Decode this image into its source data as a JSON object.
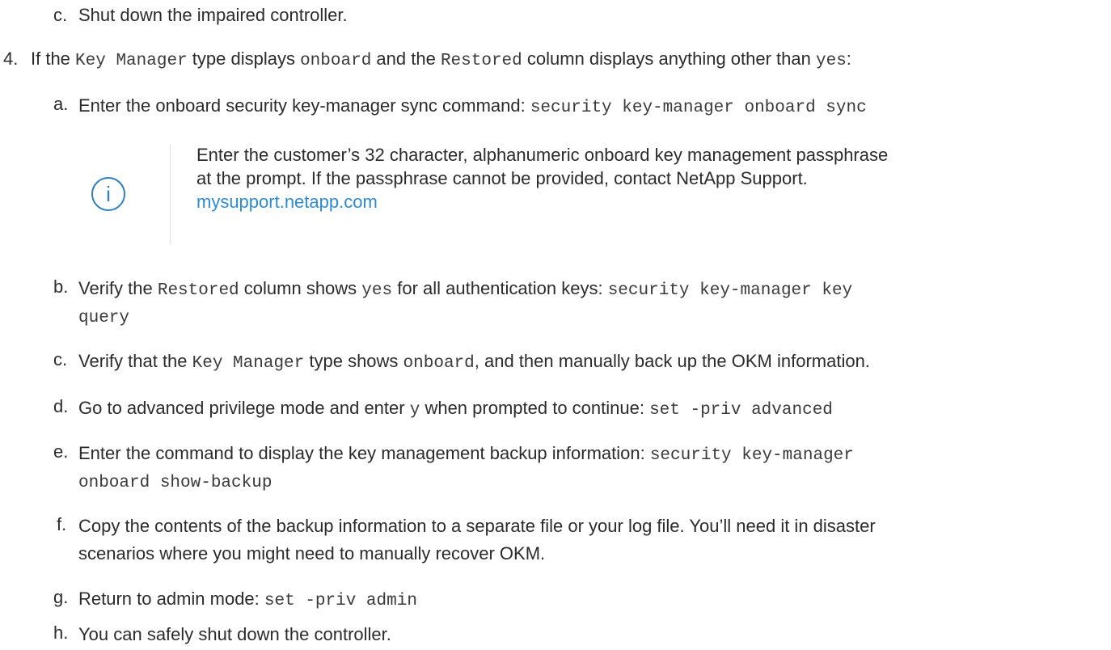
{
  "steps": {
    "c_top": {
      "marker": "c.",
      "text": "Shut down the impaired controller."
    },
    "step4": {
      "marker": "4.",
      "t1": "If the ",
      "c1": "Key Manager",
      "t2": " type displays ",
      "c2": "onboard",
      "t3": " and the ",
      "c3": "Restored",
      "t4": " column displays anything other than ",
      "c4": "yes",
      "t5": ":"
    },
    "a": {
      "marker": "a.",
      "text": "Enter the onboard security key-manager sync command: ",
      "code": "security key-manager onboard sync"
    },
    "note": {
      "icon": "info-circle-icon",
      "glyph": "i",
      "line1": "Enter the customer’s 32 character, alphanumeric onboard key management passphrase",
      "line2": "at the prompt. If the passphrase cannot be provided, contact NetApp Support.",
      "link": "mysupport.netapp.com"
    },
    "b": {
      "marker": "b.",
      "t1": "Verify the ",
      "c1": "Restored",
      "t2": " column shows ",
      "c2": "yes",
      "t3": " for all authentication keys: ",
      "code_line1": "security key-manager key",
      "code_line2": "query"
    },
    "c": {
      "marker": "c.",
      "t1": "Verify that the ",
      "c1": "Key Manager",
      "t2": " type shows ",
      "c2": "onboard",
      "t3": ", and then manually back up the OKM information."
    },
    "d": {
      "marker": "d.",
      "t1": "Go to advanced privilege mode and enter ",
      "c1": "y",
      "t2": " when prompted to continue: ",
      "code": "set -priv advanced"
    },
    "e": {
      "marker": "e.",
      "t1": "Enter the command to display the key management backup information: ",
      "code_line1": "security key-manager",
      "code_line2": "onboard show-backup"
    },
    "f": {
      "marker": "f.",
      "line1": "Copy the contents of the backup information to a separate file or your log file. You’ll need it in disaster",
      "line2": "scenarios where you might need to manually recover OKM."
    },
    "g": {
      "marker": "g.",
      "t1": "Return to admin mode: ",
      "code": "set -priv admin"
    },
    "h": {
      "marker": "h.",
      "text": "You can safely shut down the controller."
    }
  }
}
